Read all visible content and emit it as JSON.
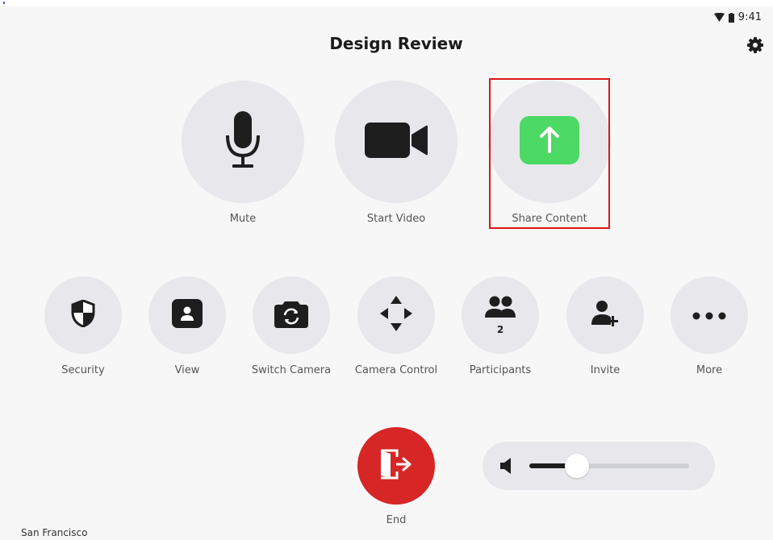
{
  "status_bar": {
    "time": "9:41"
  },
  "header": {
    "title": "Design Review"
  },
  "main_controls": [
    {
      "label": "Mute",
      "icon": "microphone-icon"
    },
    {
      "label": "Start Video",
      "icon": "video-camera-icon"
    },
    {
      "label": "Share Content",
      "icon": "share-arrow-icon",
      "accent": "#4cd964"
    }
  ],
  "secondary_controls": [
    {
      "label": "Security",
      "icon": "shield-icon"
    },
    {
      "label": "View",
      "icon": "person-card-icon"
    },
    {
      "label": "Switch Camera",
      "icon": "switch-camera-icon"
    },
    {
      "label": "Camera Control",
      "icon": "move-arrows-icon"
    },
    {
      "label": "Participants",
      "icon": "participants-icon",
      "count": "2"
    },
    {
      "label": "Invite",
      "icon": "add-person-icon"
    },
    {
      "label": "More",
      "icon": "more-dots-icon"
    }
  ],
  "end_call": {
    "label": "End",
    "icon": "exit-door-icon",
    "color": "#d62626"
  },
  "volume": {
    "level": 0.3,
    "icon": "speaker-icon"
  },
  "footer": {
    "location": "San Francisco"
  },
  "colors": {
    "highlight": "#e01515",
    "button_bg": "#e8e8ec"
  }
}
